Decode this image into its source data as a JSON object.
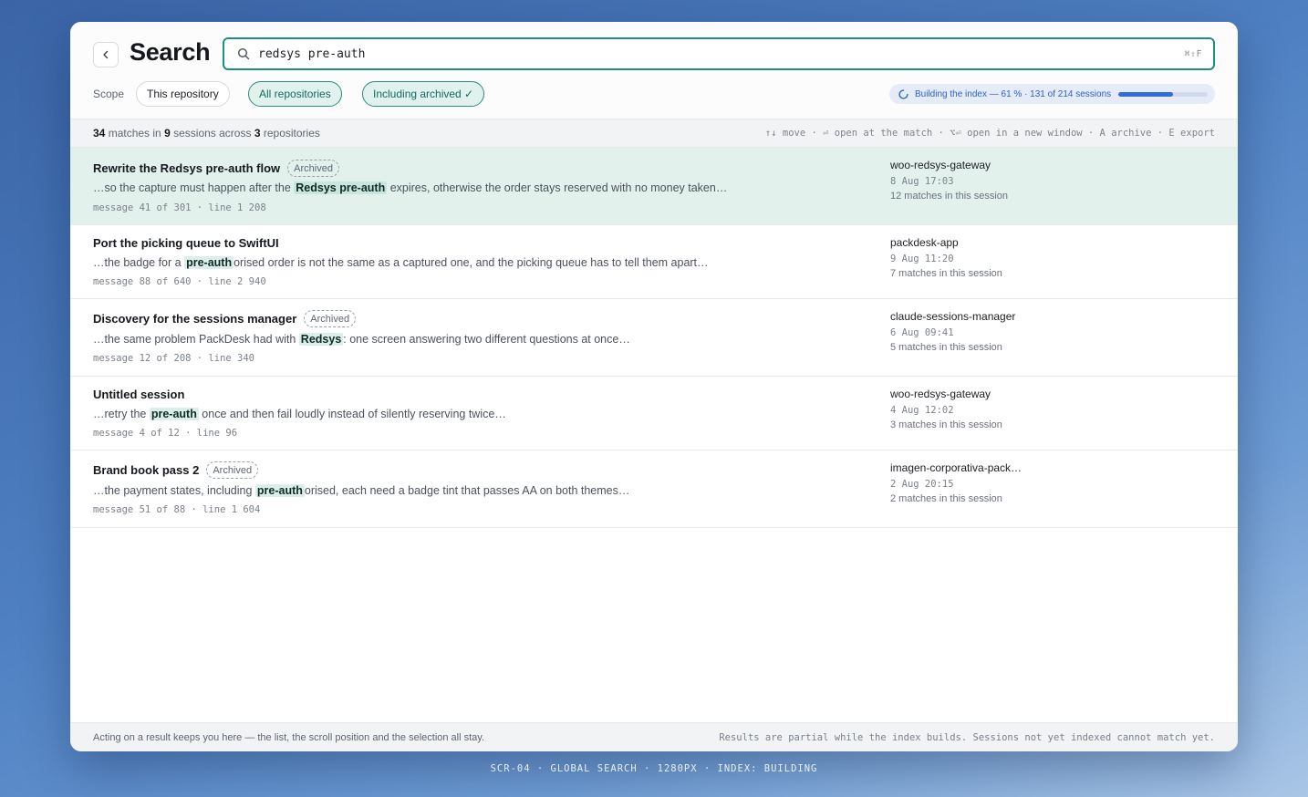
{
  "header": {
    "title": "Search",
    "query": "redsys pre-auth",
    "shortcut_hint": "⌘⇧F"
  },
  "scope": {
    "label": "Scope",
    "options": [
      {
        "label": "This repository",
        "active": false
      },
      {
        "label": "All repositories",
        "active": true
      },
      {
        "label": "Including archived ✓",
        "active": true
      }
    ]
  },
  "index_status": {
    "text": "Building the index — 61 % · 131 of 214 sessions",
    "progress_percent": 61
  },
  "summary": {
    "matches": "34",
    "matches_label": "matches in",
    "sessions": "9",
    "sessions_label": "sessions across",
    "repositories": "3",
    "repositories_label": "repositories"
  },
  "shortcuts": {
    "text": "↑↓ move · ⏎ open at the match · ⌥⏎ open in a new window · A archive · E export"
  },
  "results": [
    {
      "title": "Rewrite the Redsys pre-auth flow",
      "archived": true,
      "badge": "Archived",
      "snippet_before": "…so the capture must happen after the ",
      "snippet_match": "Redsys pre-auth",
      "snippet_after": " expires, otherwise the order stays reserved with no money taken…",
      "location": "message 41 of 301 · line 1 208",
      "repo": "woo-redsys-gateway",
      "date": "8 Aug 17:03",
      "count": "12 matches in this session",
      "selected": true
    },
    {
      "title": "Port the picking queue to SwiftUI",
      "archived": false,
      "badge": "",
      "snippet_before": "…the badge for a ",
      "snippet_match": "pre-auth",
      "snippet_after": "orised order is not the same as a captured one, and the picking queue has to tell them apart…",
      "location": "message 88 of 640 · line 2 940",
      "repo": "packdesk-app",
      "date": "9 Aug 11:20",
      "count": "7 matches in this session",
      "selected": false
    },
    {
      "title": "Discovery for the sessions manager",
      "archived": true,
      "badge": "Archived",
      "snippet_before": "…the same problem PackDesk had with ",
      "snippet_match": "Redsys",
      "snippet_after": ": one screen answering two different questions at once…",
      "location": "message 12 of 208 · line 340",
      "repo": "claude-sessions-manager",
      "date": "6 Aug 09:41",
      "count": "5 matches in this session",
      "selected": false
    },
    {
      "title": "Untitled session",
      "archived": false,
      "badge": "",
      "snippet_before": "…retry the ",
      "snippet_match": "pre-auth",
      "snippet_after": " once and then fail loudly instead of silently reserving twice…",
      "location": "message 4 of 12 · line 96",
      "repo": "woo-redsys-gateway",
      "date": "4 Aug 12:02",
      "count": "3 matches in this session",
      "selected": false
    },
    {
      "title": "Brand book pass 2",
      "archived": true,
      "badge": "Archived",
      "snippet_before": "…the payment states, including ",
      "snippet_match": "pre-auth",
      "snippet_after": "orised, each need a badge tint that passes AA on both themes…",
      "location": "message 51 of 88 · line 1 604",
      "repo": "imagen-corporativa-pack…",
      "date": "2 Aug 20:15",
      "count": "2 matches in this session",
      "selected": false
    }
  ],
  "footer": {
    "left": "Acting on a result keeps you here — the list, the scroll position and the selection all stay.",
    "right": "Results are partial while the index builds. Sessions not yet indexed cannot match yet."
  },
  "caption": "SCR-04 · GLOBAL SEARCH · 1280PX · INDEX: BUILDING",
  "colors": {
    "accent": "#1c8f80",
    "selected_row": "#e3f1ed",
    "progress": "#2f6fd6"
  },
  "icons": {
    "back": "chevron-left-icon",
    "search": "search-icon",
    "status": "spinner-icon"
  }
}
